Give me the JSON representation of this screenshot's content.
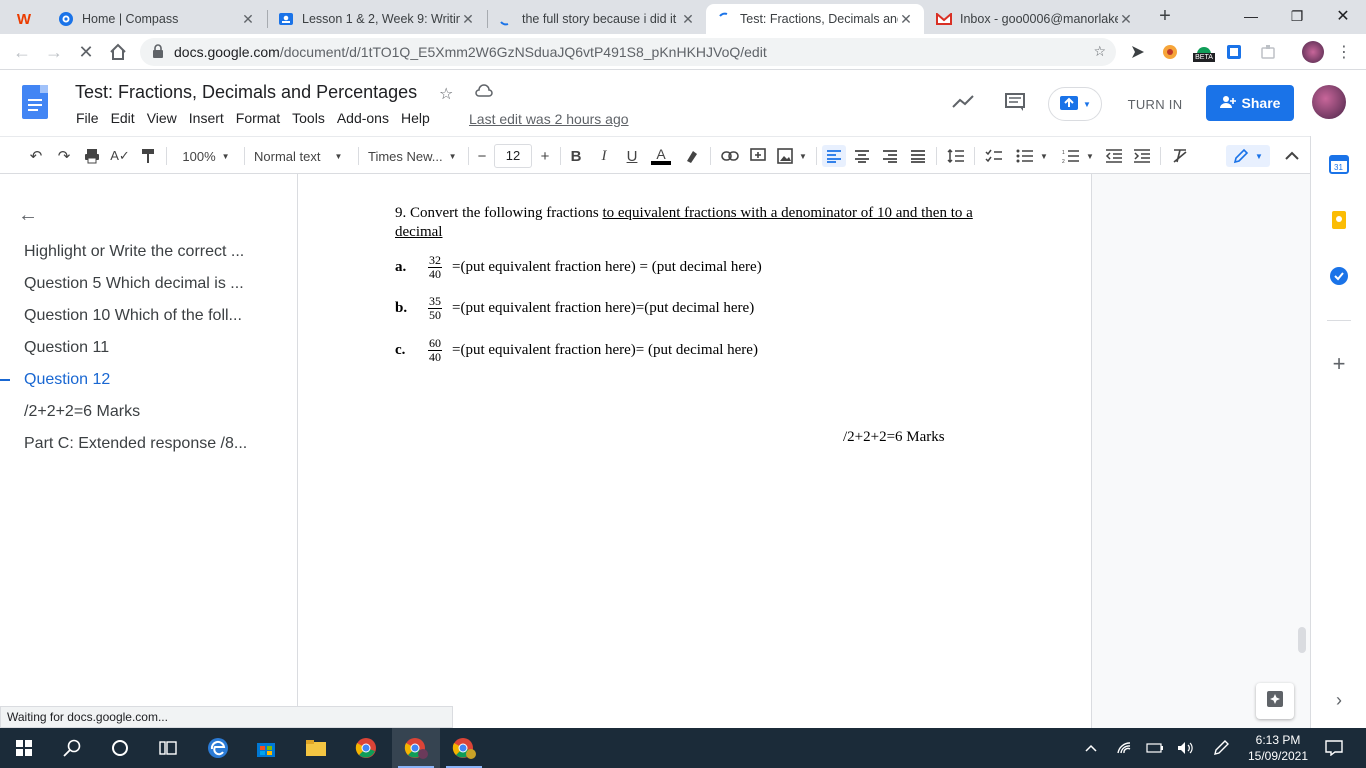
{
  "browser": {
    "tabs": [
      {
        "title": "",
        "icon": "office-icon",
        "color": "#eb3c00"
      },
      {
        "title": "Home | Compass",
        "icon": "compass-icon",
        "color": "#1a73e8"
      },
      {
        "title": "Lesson 1 & 2, Week 9: Writin",
        "icon": "classroom-icon",
        "color": "#1a73e8"
      },
      {
        "title": "the full story because i did it",
        "icon": "loading-icon",
        "color": "#1a73e8"
      },
      {
        "title": "Test: Fractions, Decimals and",
        "icon": "loading-icon",
        "color": "#1a73e8"
      },
      {
        "title": "Inbox - goo0006@manorlake",
        "icon": "gmail-icon",
        "color": "#d93025"
      }
    ],
    "url_host": "docs.google.com",
    "url_path": "/document/d/1tTO1Q_E5Xmm2W6GzNSduaJQ6vtP491S8_pKnHKHJVoQ/edit",
    "ext_badge": "BETA"
  },
  "docs": {
    "title": "Test: Fractions, Decimals and Percentages",
    "menu": [
      "File",
      "Edit",
      "View",
      "Insert",
      "Format",
      "Tools",
      "Add-ons",
      "Help"
    ],
    "last_edit": "Last edit was 2 hours ago",
    "turn_in": "TURN IN",
    "share": "Share",
    "toolbar": {
      "zoom": "100%",
      "style": "Normal text",
      "font": "Times New...",
      "font_size": "12"
    }
  },
  "outline": {
    "items": [
      "Highlight or Write the correct ...",
      "Question 5 Which decimal is ...",
      "Question 10 Which of the foll...",
      "Question 11",
      "Question 12",
      "/2+2+2=6 Marks",
      "Part C: Extended response /8..."
    ],
    "active_index": 4
  },
  "document": {
    "question_plain": "9. Convert the following fractions ",
    "question_underlined": "to equivalent fractions with a denominator of 10 and then to a decimal",
    "rows": [
      {
        "label": "a.",
        "num": "32",
        "den": "40",
        "text": "=(put equivalent fraction here) = (put decimal here)"
      },
      {
        "label": "b.",
        "num": "35",
        "den": "50",
        "text": "=(put equivalent fraction here)=(put decimal here)"
      },
      {
        "label": "c.",
        "num": "60",
        "den": "40",
        "text": "=(put equivalent fraction here)= (put decimal here)"
      }
    ],
    "marks": "/2+2+2=6 Marks"
  },
  "status_text": "Waiting for docs.google.com...",
  "taskbar": {
    "time": "6:13 PM",
    "date": "15/09/2021"
  },
  "colors": {
    "accent": "#1a73e8",
    "taskbar": "#1b2b39"
  }
}
